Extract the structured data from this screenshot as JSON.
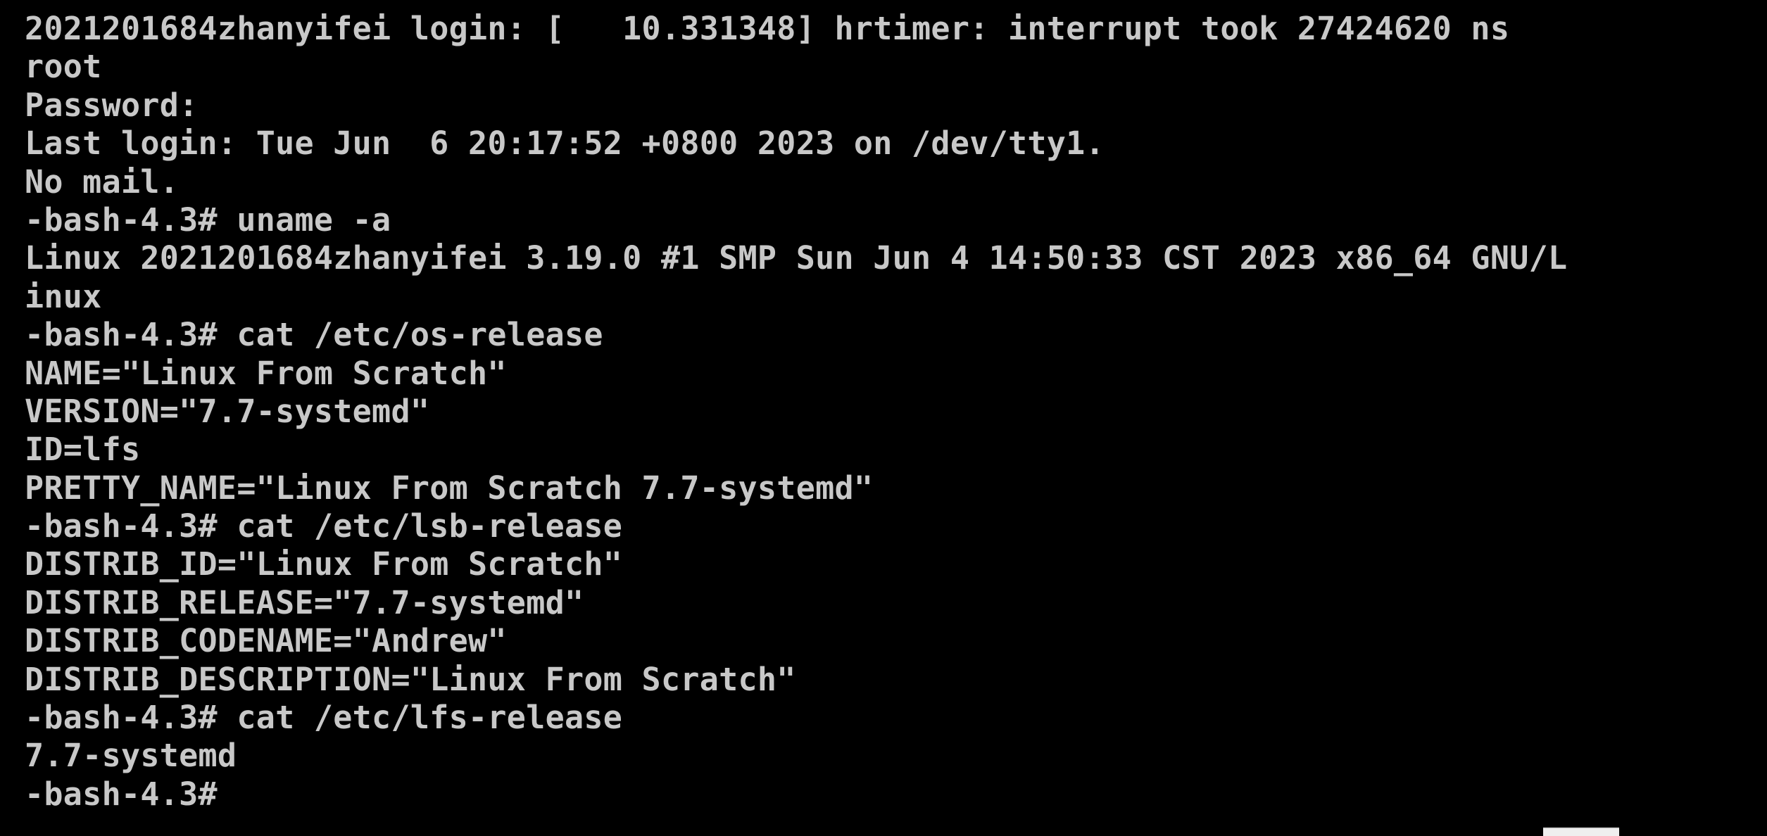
{
  "terminal": {
    "colors": {
      "background": "#000000",
      "foreground": "#c8c8c8"
    },
    "lines": [
      "2021201684zhanyifei login: [   10.331348] hrtimer: interrupt took 27424620 ns",
      "root",
      "Password:",
      "Last login: Tue Jun  6 20:17:52 +0800 2023 on /dev/tty1.",
      "No mail.",
      "-bash-4.3# uname -a",
      "Linux 2021201684zhanyifei 3.19.0 #1 SMP Sun Jun 4 14:50:33 CST 2023 x86_64 GNU/L",
      "inux",
      "-bash-4.3# cat /etc/os-release",
      "NAME=\"Linux From Scratch\"",
      "VERSION=\"7.7-systemd\"",
      "ID=lfs",
      "PRETTY_NAME=\"Linux From Scratch 7.7-systemd\"",
      "-bash-4.3# cat /etc/lsb-release",
      "DISTRIB_ID=\"Linux From Scratch\"",
      "DISTRIB_RELEASE=\"7.7-systemd\"",
      "DISTRIB_CODENAME=\"Andrew\"",
      "DISTRIB_DESCRIPTION=\"Linux From Scratch\"",
      "-bash-4.3# cat /etc/lfs-release",
      "7.7-systemd",
      "-bash-4.3#"
    ]
  }
}
